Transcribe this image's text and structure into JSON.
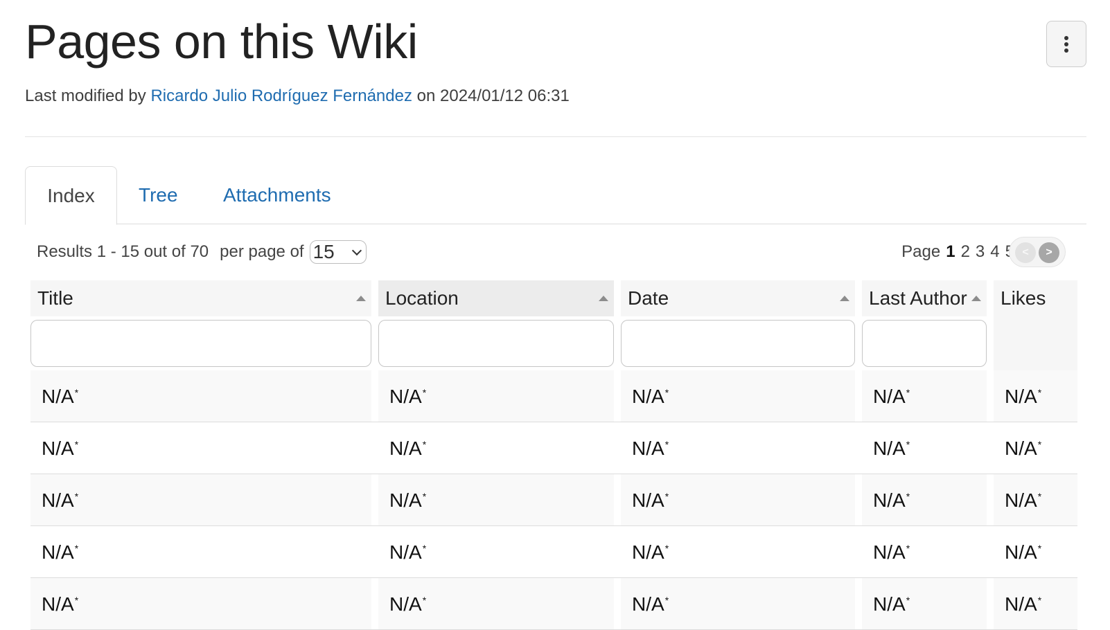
{
  "page": {
    "title": "Pages on this Wiki",
    "modified_prefix": "Last modified by",
    "modified_author": "Ricardo Julio Rodríguez Fernández",
    "modified_on": "on 2024/01/12 06:31"
  },
  "tabs": [
    {
      "label": "Index",
      "active": true
    },
    {
      "label": "Tree",
      "active": false
    },
    {
      "label": "Attachments",
      "active": false
    }
  ],
  "toolbar": {
    "results_text": "Results 1 - 15 out of 70",
    "per_page_label": "per page of",
    "per_page_value": "15"
  },
  "pager": {
    "label": "Page",
    "pages": [
      "1",
      "2",
      "3",
      "4",
      "5"
    ],
    "current": "1",
    "prev_symbol": "<",
    "next_symbol": ">"
  },
  "table": {
    "columns": [
      "Title",
      "Location",
      "Date",
      "Last Author",
      "Likes"
    ],
    "sorted_column": "Location",
    "rows": [
      [
        "N/A",
        "N/A",
        "N/A",
        "N/A",
        "N/A"
      ],
      [
        "N/A",
        "N/A",
        "N/A",
        "N/A",
        "N/A"
      ],
      [
        "N/A",
        "N/A",
        "N/A",
        "N/A",
        "N/A"
      ],
      [
        "N/A",
        "N/A",
        "N/A",
        "N/A",
        "N/A"
      ],
      [
        "N/A",
        "N/A",
        "N/A",
        "N/A",
        "N/A"
      ]
    ],
    "cell_marker": "*"
  },
  "icons": {
    "more": "vertical-dots-icon",
    "sort": "sort-up-icon",
    "select": "chevron-down-icon"
  }
}
